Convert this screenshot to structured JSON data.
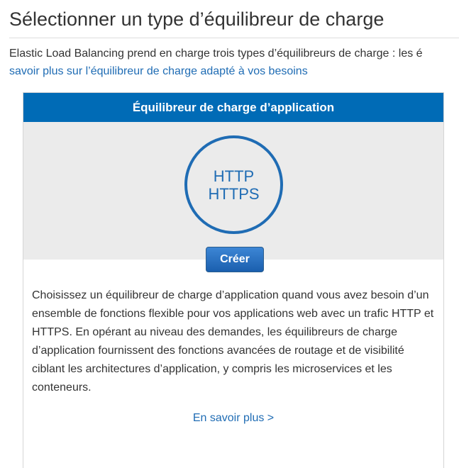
{
  "page": {
    "title": "Sélectionner un type d’équilibreur de charge",
    "intro_text": "Elastic Load Balancing prend en charge trois types d’équilibreurs de charge : les é",
    "intro_link": "savoir plus sur l’équilibreur de charge adapté à vos besoins"
  },
  "card": {
    "header": "Équilibreur de charge d’application",
    "protocols": [
      "HTTP",
      "HTTPS"
    ],
    "create_button": "Créer",
    "description": "Choisissez un équilibreur de charge d’application quand vous avez besoin d’un ensemble de fonctions flexible pour vos applications web avec un trafic HTTP et HTTPS. En opérant au niveau des demandes, les équilibreurs de charge d’application fournissent des fonctions avancées de routage et de visibilité ciblant les architectures d’application, y compris les microservices et les conteneurs.",
    "learn_more": "En savoir plus >"
  },
  "colors": {
    "header_blue": "#006bb6",
    "link_blue": "#1f6cb4",
    "visual_bg": "#ebebeb"
  }
}
